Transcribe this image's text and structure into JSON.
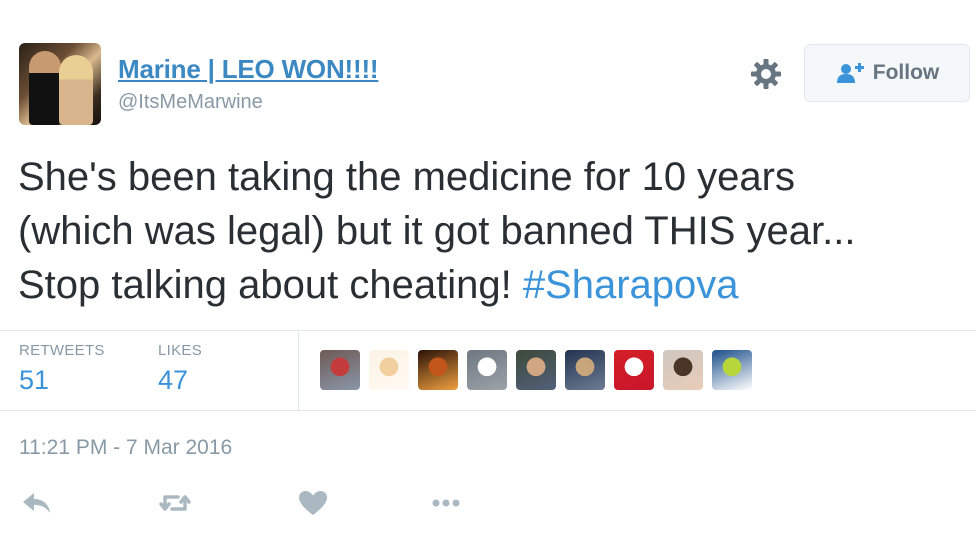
{
  "user": {
    "display_name": "Marine | LEO WON!!!!",
    "handle": "@ItsMeMarwine"
  },
  "follow_button": {
    "label": "Follow"
  },
  "tweet": {
    "lines": [
      "She's been taking the medicine for 10 years",
      "(which was legal) but it got banned THIS year...",
      "Stop talking about cheating! "
    ],
    "hashtag": "#Sharapova"
  },
  "stats": {
    "retweets": {
      "label": "RETWEETS",
      "value": "51"
    },
    "likes": {
      "label": "LIKES",
      "value": "47"
    }
  },
  "likers": [
    {
      "name": "liker-1",
      "colors": [
        "#6d5a55",
        "#c43b3b",
        "#8a96a8"
      ]
    },
    {
      "name": "liker-2",
      "colors": [
        "#fbf3e6",
        "#f2cf9e",
        "#fffaf2"
      ]
    },
    {
      "name": "liker-3",
      "colors": [
        "#2a1206",
        "#c2561a",
        "#f0a040"
      ]
    },
    {
      "name": "liker-4",
      "colors": [
        "#6f7780",
        "#ffffff",
        "#9aa2aa"
      ]
    },
    {
      "name": "liker-5",
      "colors": [
        "#3d4a3a",
        "#d2a683",
        "#52607a"
      ]
    },
    {
      "name": "liker-6",
      "colors": [
        "#24344f",
        "#c9a57c",
        "#6d7c94"
      ]
    },
    {
      "name": "liker-7",
      "colors": [
        "#d41f26",
        "#ffffff",
        "#c8162b"
      ]
    },
    {
      "name": "liker-8",
      "colors": [
        "#cfc7c0",
        "#4a3526",
        "#e8cdb8"
      ]
    },
    {
      "name": "liker-9",
      "colors": [
        "#1b4f8a",
        "#b6d63b",
        "#ffffff"
      ]
    }
  ],
  "timestamp": "11:21 PM - 7 Mar 2016",
  "colors": {
    "link_blue": "#3b88c3",
    "hashtag_blue": "#3b94d9",
    "text": "#292f33",
    "muted": "#8899a6",
    "icon_gray": "#aab8c2"
  },
  "actions": [
    "reply-icon",
    "retweet-icon",
    "like-icon",
    "more-icon"
  ]
}
